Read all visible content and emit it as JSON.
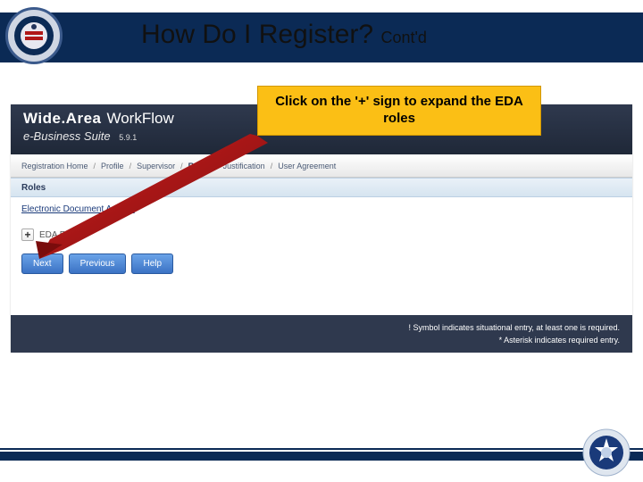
{
  "slide": {
    "title_main": "How Do I Register?",
    "title_suffix": "Cont'd"
  },
  "callout": {
    "text": "Click on the '+' sign to expand the EDA roles"
  },
  "app": {
    "brand_wide": "Wide.Area",
    "brand_workflow": "WorkFlow",
    "brand_sub": "e-Business Suite",
    "version": "5.9.1"
  },
  "breadcrumb": {
    "items": [
      {
        "label": "Registration Home",
        "active": false
      },
      {
        "label": "Profile",
        "active": false
      },
      {
        "label": "Supervisor",
        "active": false
      },
      {
        "label": "Roles",
        "active": true
      },
      {
        "label": "Justification",
        "active": false
      },
      {
        "label": "User Agreement",
        "active": false
      }
    ],
    "sep": "/"
  },
  "section": {
    "title": "Roles",
    "link": "Electronic Document Access",
    "expand_label": "EDA Role",
    "plus": "+"
  },
  "buttons": {
    "next": "Next",
    "previous": "Previous",
    "help": "Help"
  },
  "footer": {
    "situational": "! Symbol indicates situational entry, at least one is required.",
    "required": "* Asterisk indicates required entry."
  }
}
